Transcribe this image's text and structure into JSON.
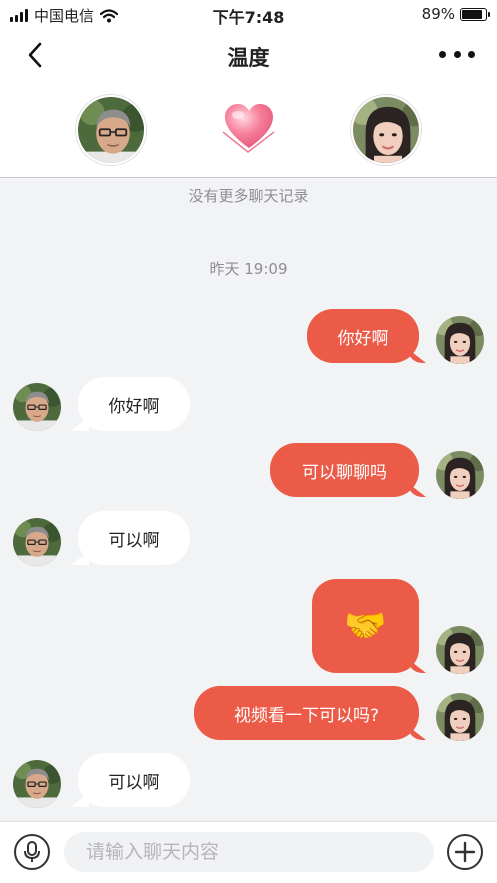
{
  "status_bar": {
    "carrier": "中国电信",
    "time": "下午7:48",
    "battery_percent": "89%",
    "battery_level": 0.89,
    "icons": [
      "signal-icon",
      "wifi-icon",
      "battery-icon"
    ]
  },
  "header": {
    "title": "温度",
    "icons": [
      "back-chevron-icon",
      "more-dots-icon",
      "heart-icon"
    ]
  },
  "chat": {
    "no_more_records": "没有更多聊天记录",
    "timestamp": "昨天 19:09",
    "messages": [
      {
        "from": "me",
        "text": "你好啊"
      },
      {
        "from": "other",
        "text": "你好啊"
      },
      {
        "from": "me",
        "text": "可以聊聊吗"
      },
      {
        "from": "other",
        "text": "可以啊"
      },
      {
        "from": "me",
        "text": "🤝",
        "type": "emoji"
      },
      {
        "from": "me",
        "text": "视频看一下可以吗?"
      },
      {
        "from": "other",
        "text": "可以啊"
      }
    ]
  },
  "input_bar": {
    "placeholder": "请输入聊天内容",
    "value": "",
    "icons": [
      "microphone-icon",
      "plus-icon"
    ]
  },
  "colors": {
    "accent": "#ec5a48",
    "heart": "#f06b8c",
    "background": "#f2f3f5"
  }
}
